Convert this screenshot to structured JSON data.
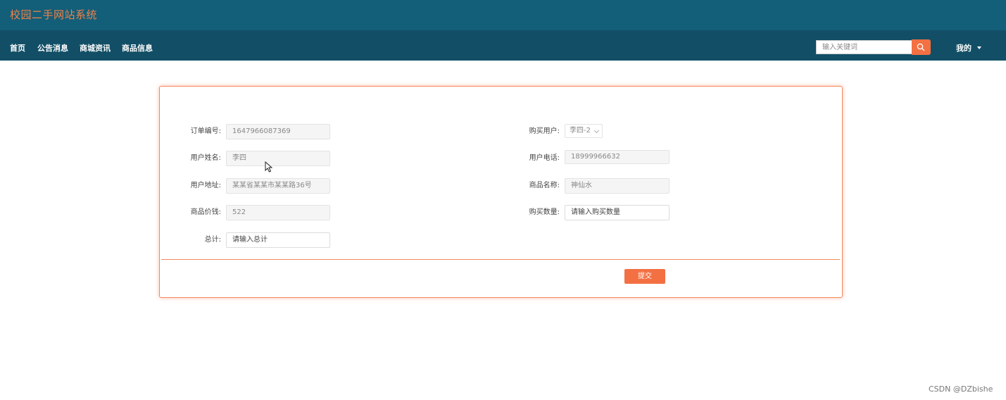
{
  "header": {
    "site_title": "校园二手网站系统",
    "accent_color": "#f37043",
    "topbar_color": "#135e78",
    "navbar_color": "#124f66"
  },
  "nav": {
    "items": [
      {
        "label": "首页"
      },
      {
        "label": "公告消息"
      },
      {
        "label": "商城资讯"
      },
      {
        "label": "商品信息"
      }
    ],
    "search_placeholder": "输入关键词",
    "search_icon": "search-icon",
    "user_menu_label": "我的"
  },
  "form": {
    "order_no": {
      "label": "订单编号:",
      "value": "1647966087369"
    },
    "buyer_user": {
      "label": "购买用户:",
      "value": "李四-2"
    },
    "user_name": {
      "label": "用户姓名:",
      "value": "李四"
    },
    "user_phone": {
      "label": "用户电话:",
      "value": "18999966632"
    },
    "user_address": {
      "label": "用户地址:",
      "value": "某某省某某市某某路36号"
    },
    "product_name": {
      "label": "商品名称:",
      "value": "神仙水"
    },
    "product_price": {
      "label": "商品价钱:",
      "value": "522"
    },
    "quantity": {
      "label": "购买数量:",
      "placeholder": "请输入购买数量"
    },
    "total": {
      "label": "总计:",
      "placeholder": "请输入总计"
    },
    "submit_label": "提交"
  },
  "watermark": "CSDN @DZbishe"
}
